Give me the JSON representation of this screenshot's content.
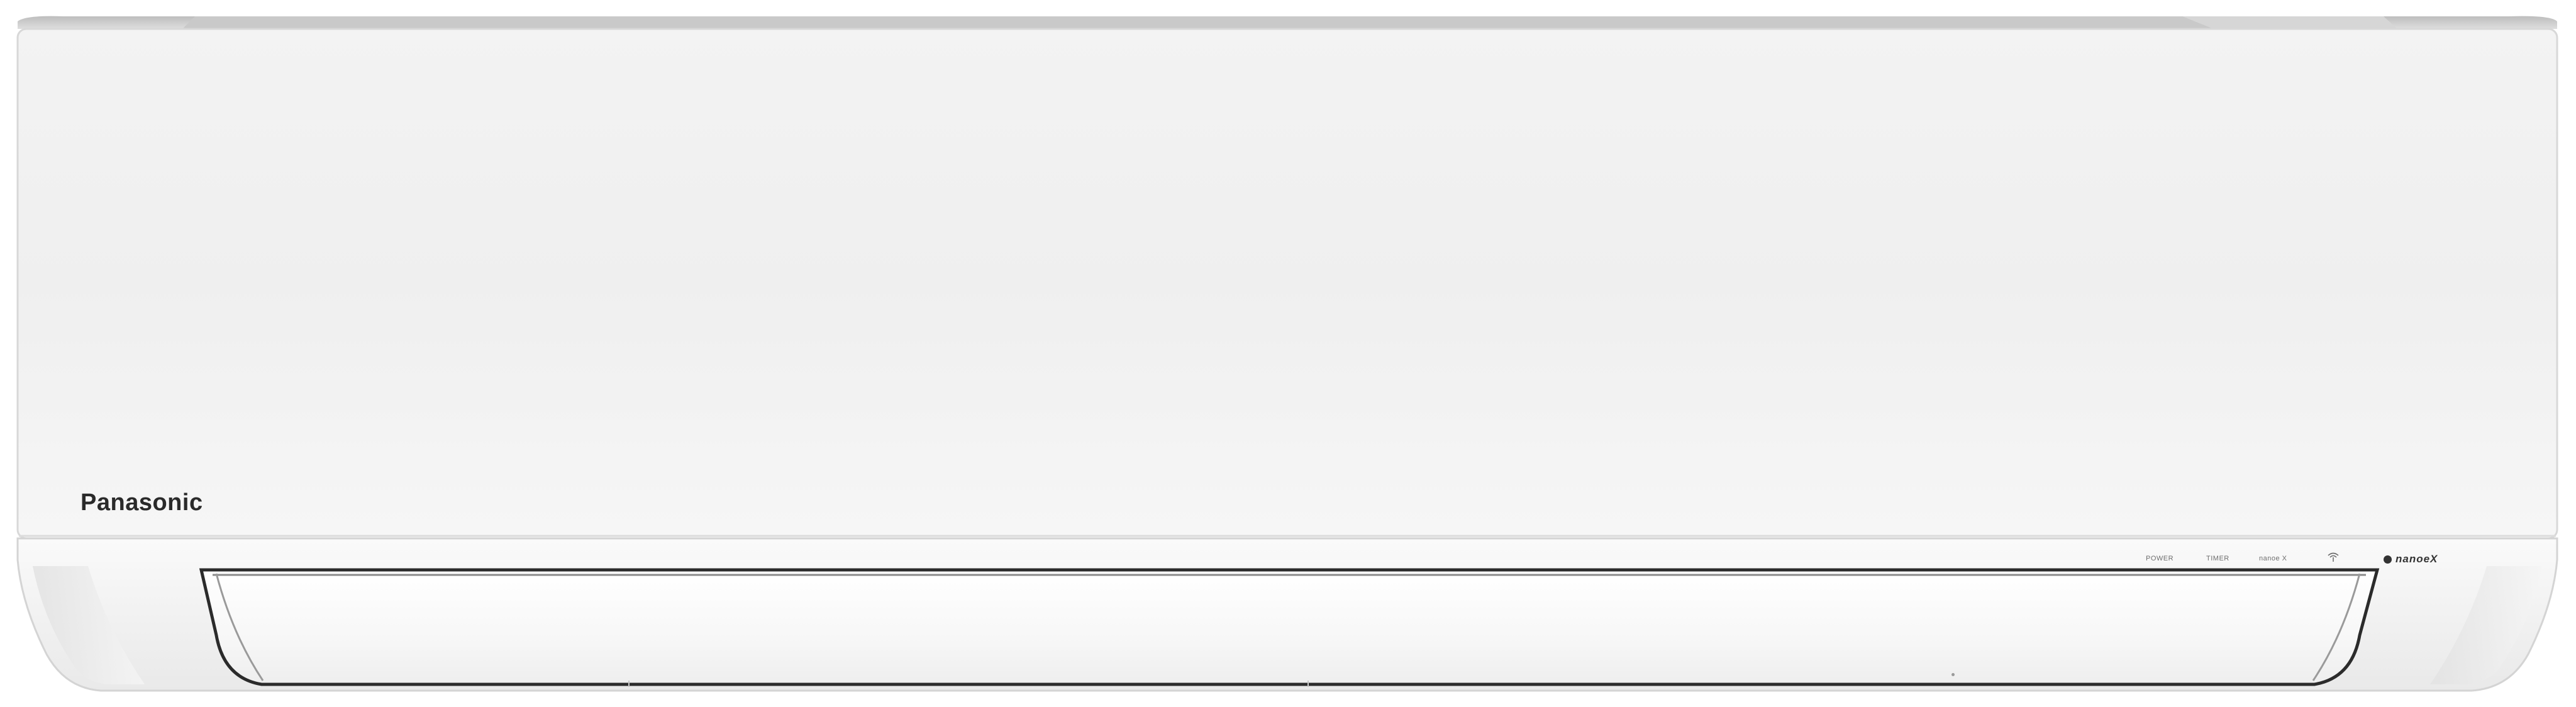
{
  "product": {
    "brand": "Panasonic",
    "indicators": {
      "power": "POWER",
      "timer": "TIMER",
      "nanoe": "nanoe X"
    },
    "nanoe_badge": "nanoeX",
    "wifi_icon": "wifi-icon"
  }
}
